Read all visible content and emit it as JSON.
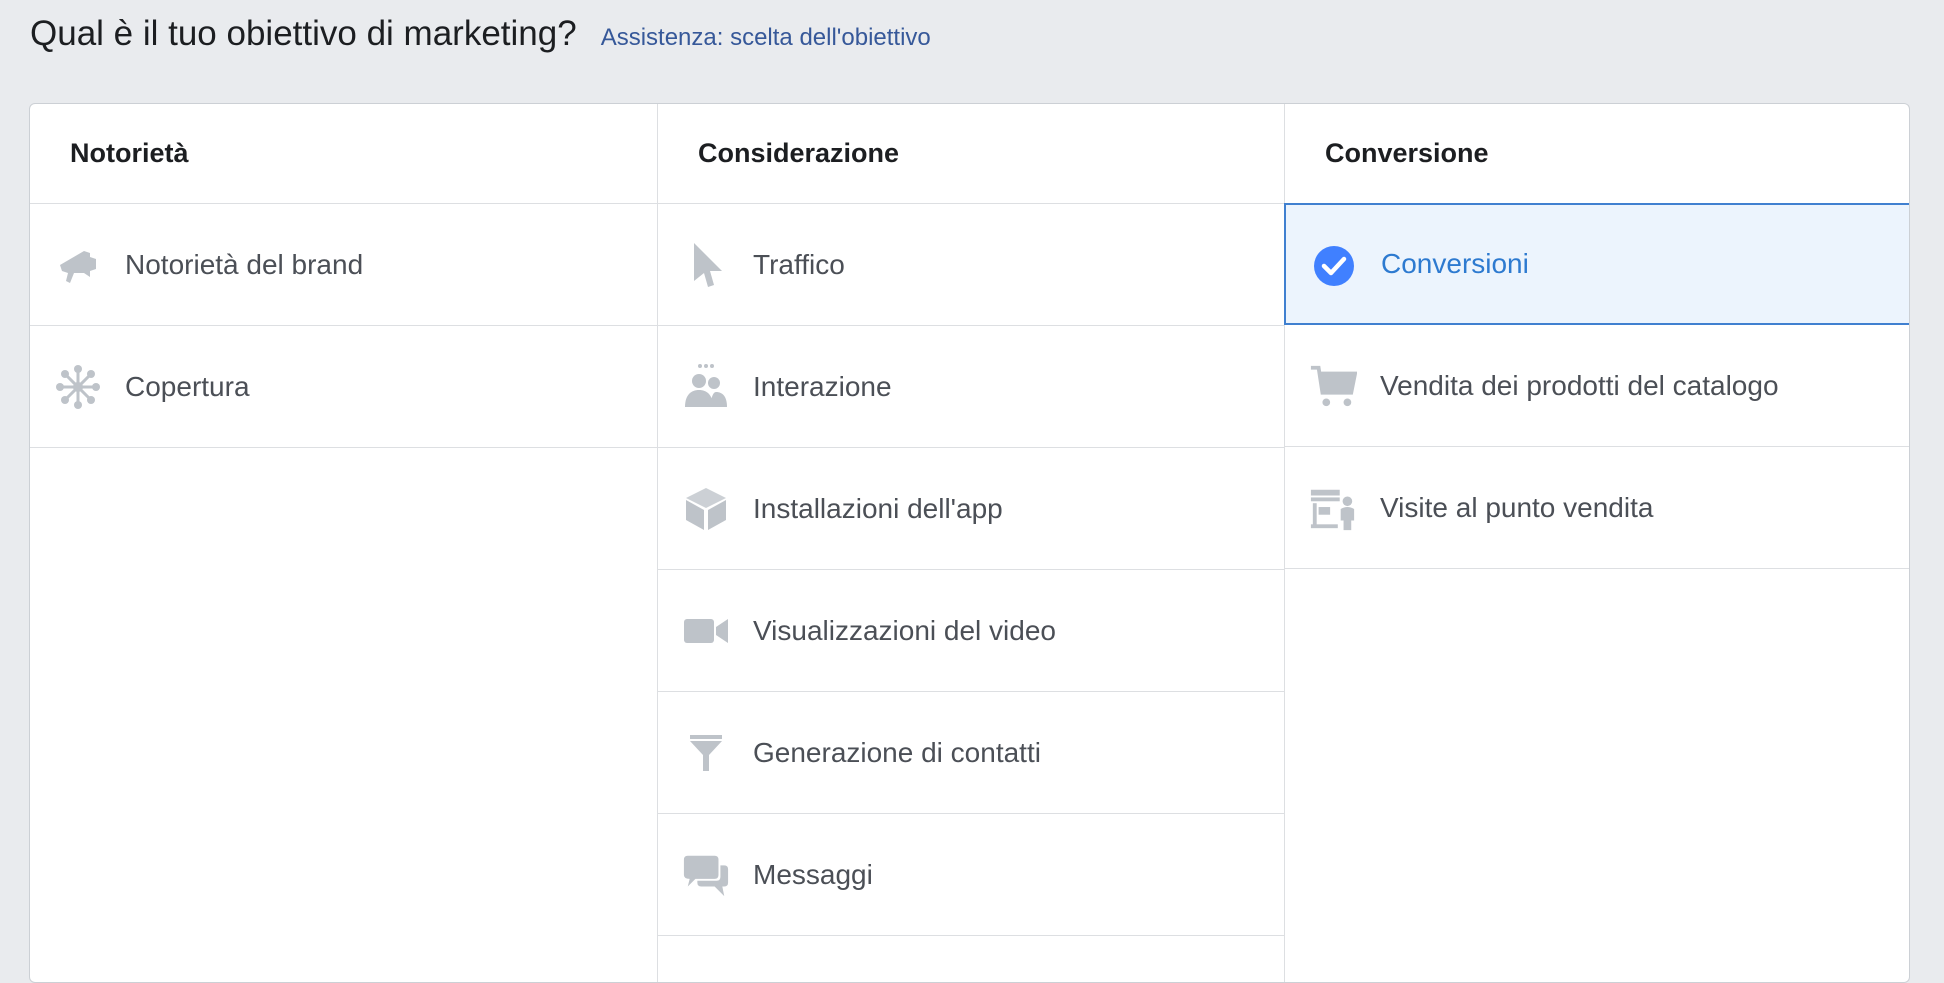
{
  "header": {
    "title": "Qual è il tuo obiettivo di marketing?",
    "help_link": "Assistenza: scelta dell'obiettivo"
  },
  "columns": [
    {
      "title": "Notorietà",
      "options": [
        {
          "label": "Notorietà del brand",
          "icon": "megaphone-icon"
        },
        {
          "label": "Copertura",
          "icon": "network-icon"
        }
      ]
    },
    {
      "title": "Considerazione",
      "options": [
        {
          "label": "Traffico",
          "icon": "cursor-icon"
        },
        {
          "label": "Interazione",
          "icon": "people-icon"
        },
        {
          "label": "Installazioni dell'app",
          "icon": "box-icon"
        },
        {
          "label": "Visualizzazioni del video",
          "icon": "video-camera-icon"
        },
        {
          "label": "Generazione di contatti",
          "icon": "funnel-icon"
        },
        {
          "label": "Messaggi",
          "icon": "chat-bubbles-icon"
        }
      ]
    },
    {
      "title": "Conversione",
      "options": [
        {
          "label": "Conversioni",
          "icon": "check-circle-icon",
          "selected": true
        },
        {
          "label": "Vendita dei prodotti del catalogo",
          "icon": "shopping-cart-icon"
        },
        {
          "label": "Visite al punto vendita",
          "icon": "storefront-icon"
        }
      ]
    }
  ],
  "colors": {
    "icon_gray": "#bec3c9",
    "selected_blue": "#4080ff",
    "selected_bg": "#ecf4fd",
    "link": "#365899"
  }
}
